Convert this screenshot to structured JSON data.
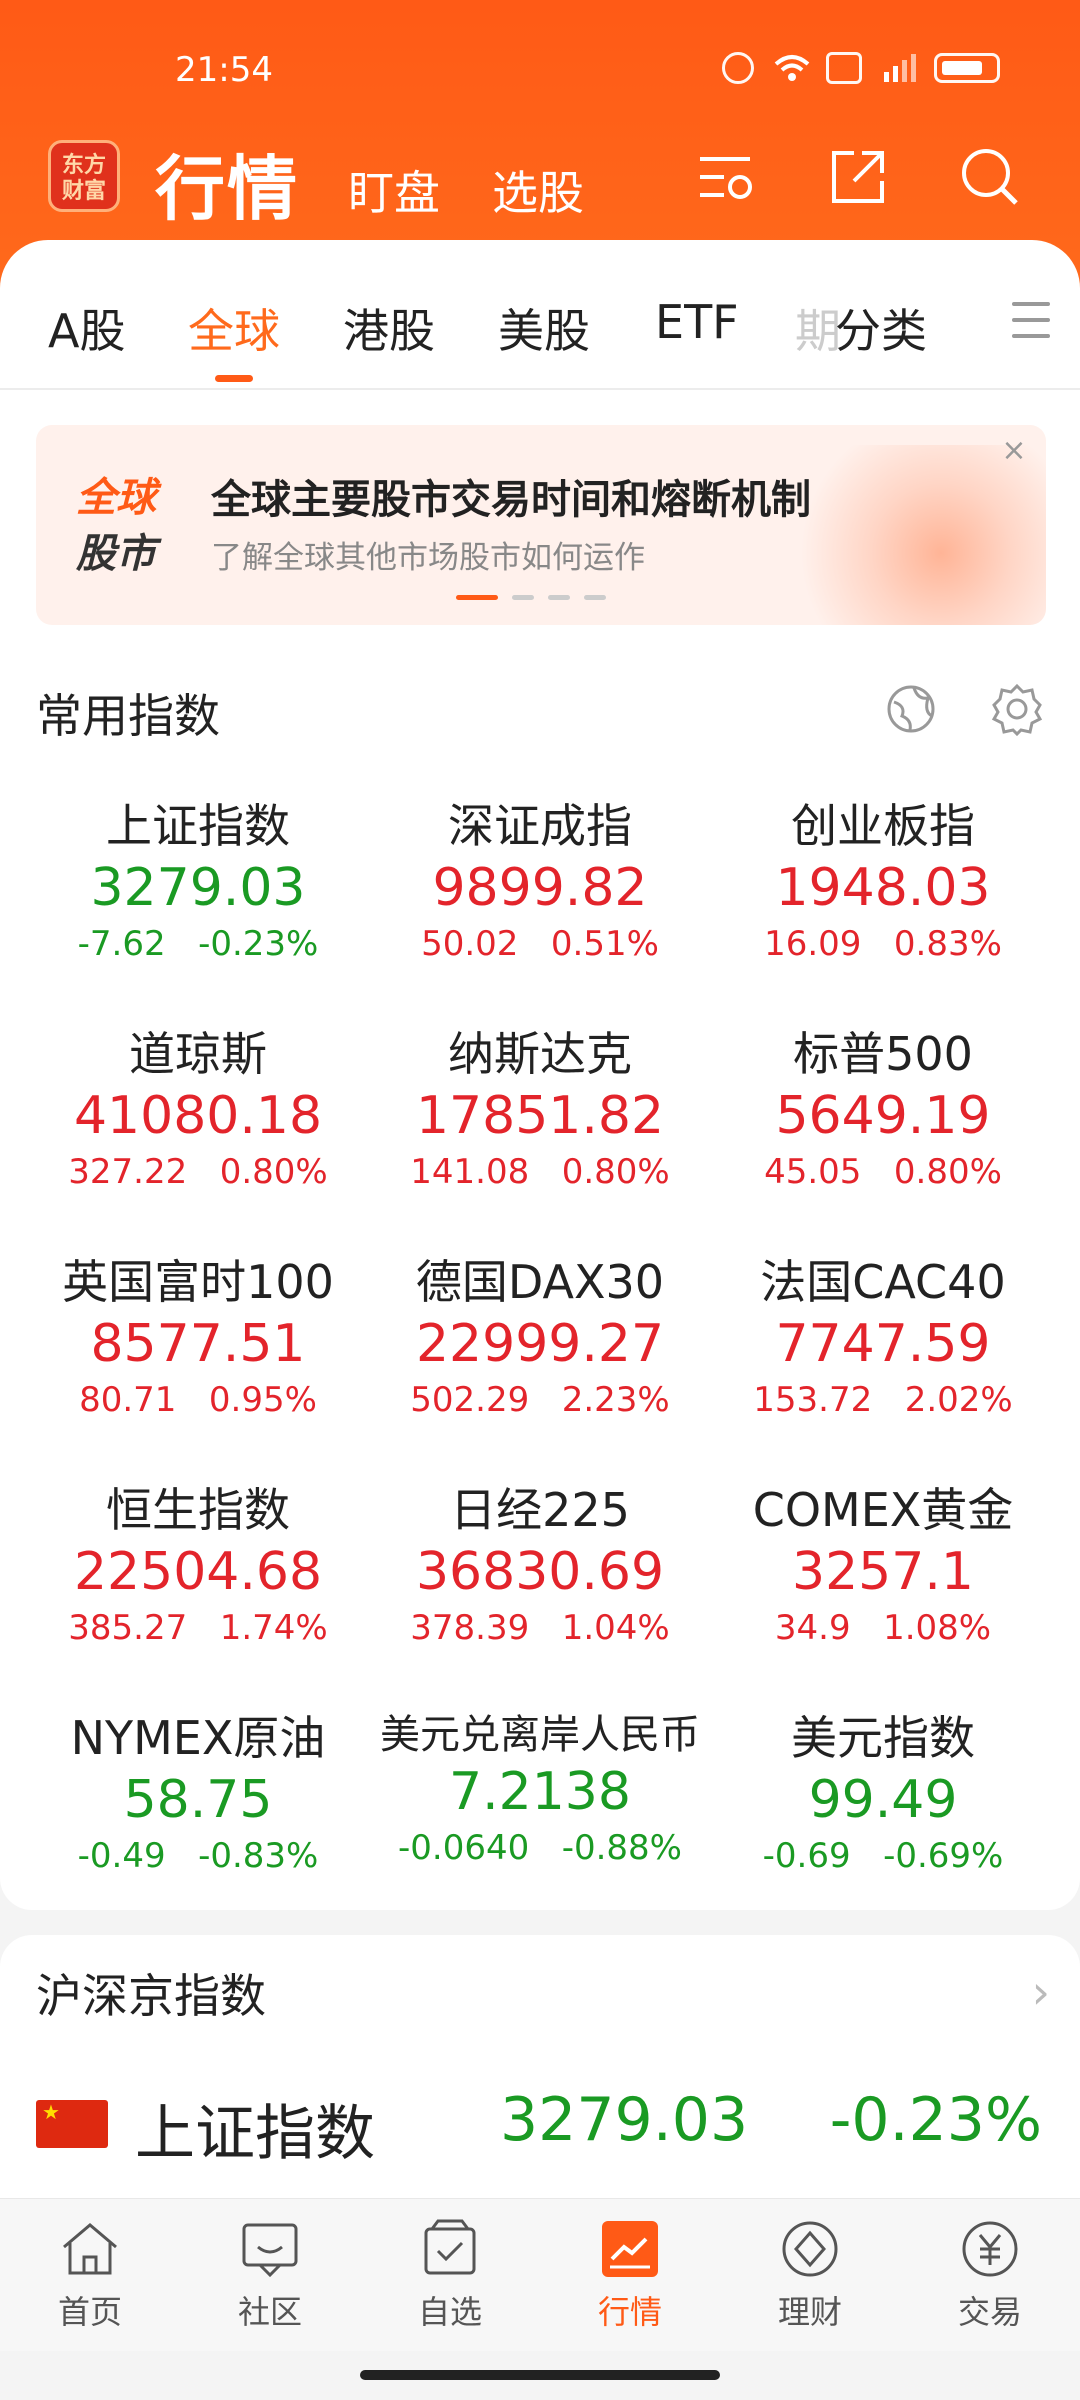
{
  "status_bar": {
    "time": "21:54"
  },
  "top_nav": {
    "logo_text": "东方\n财富",
    "title": "行情",
    "links": [
      "盯盘",
      "选股"
    ]
  },
  "tabs": [
    "A股",
    "全球",
    "港股",
    "美股",
    "ETF",
    "期",
    "分类"
  ],
  "active_tab": "全球",
  "banner": {
    "tag_line1": "全球",
    "tag_line2": "股市",
    "title": "全球主要股市交易时间和熔断机制",
    "subtitle": "了解全球其他市场股市如何运作",
    "close": "×"
  },
  "common_indices": {
    "title": "常用指数",
    "items": [
      {
        "name": "上证指数",
        "price": "3279.03",
        "change": "-7.62",
        "pct": "-0.23%",
        "dir": "down"
      },
      {
        "name": "深证成指",
        "price": "9899.82",
        "change": "50.02",
        "pct": "0.51%",
        "dir": "up"
      },
      {
        "name": "创业板指",
        "price": "1948.03",
        "change": "16.09",
        "pct": "0.83%",
        "dir": "up"
      },
      {
        "name": "道琼斯",
        "price": "41080.18",
        "change": "327.22",
        "pct": "0.80%",
        "dir": "up"
      },
      {
        "name": "纳斯达克",
        "price": "17851.82",
        "change": "141.08",
        "pct": "0.80%",
        "dir": "up"
      },
      {
        "name": "标普500",
        "price": "5649.19",
        "change": "45.05",
        "pct": "0.80%",
        "dir": "up"
      },
      {
        "name": "英国富时100",
        "price": "8577.51",
        "change": "80.71",
        "pct": "0.95%",
        "dir": "up"
      },
      {
        "name": "德国DAX30",
        "price": "22999.27",
        "change": "502.29",
        "pct": "2.23%",
        "dir": "up"
      },
      {
        "name": "法国CAC40",
        "price": "7747.59",
        "change": "153.72",
        "pct": "2.02%",
        "dir": "up"
      },
      {
        "name": "恒生指数",
        "price": "22504.68",
        "change": "385.27",
        "pct": "1.74%",
        "dir": "up"
      },
      {
        "name": "日经225",
        "price": "36830.69",
        "change": "378.39",
        "pct": "1.04%",
        "dir": "up"
      },
      {
        "name": "COMEX黄金",
        "price": "3257.1",
        "change": "34.9",
        "pct": "1.08%",
        "dir": "up"
      },
      {
        "name": "NYMEX原油",
        "price": "58.75",
        "change": "-0.49",
        "pct": "-0.83%",
        "dir": "down"
      },
      {
        "name": "美元兑离岸人民币",
        "price": "7.2138",
        "change": "-0.0640",
        "pct": "-0.88%",
        "dir": "down"
      },
      {
        "name": "美元指数",
        "price": "99.49",
        "change": "-0.69",
        "pct": "-0.69%",
        "dir": "down"
      }
    ]
  },
  "hushen": {
    "title": "沪深京指数",
    "row": {
      "name": "上证指数",
      "price": "3279.03",
      "pct": "-0.23%"
    }
  },
  "bottom_nav": [
    {
      "label": "首页",
      "icon": "home-icon"
    },
    {
      "label": "社区",
      "icon": "community-icon"
    },
    {
      "label": "自选",
      "icon": "watchlist-icon"
    },
    {
      "label": "行情",
      "icon": "market-icon"
    },
    {
      "label": "理财",
      "icon": "wealth-icon"
    },
    {
      "label": "交易",
      "icon": "trade-icon"
    }
  ],
  "colors": {
    "brand": "#ff5a16",
    "up": "#e3242b",
    "down": "#1a9a23"
  }
}
